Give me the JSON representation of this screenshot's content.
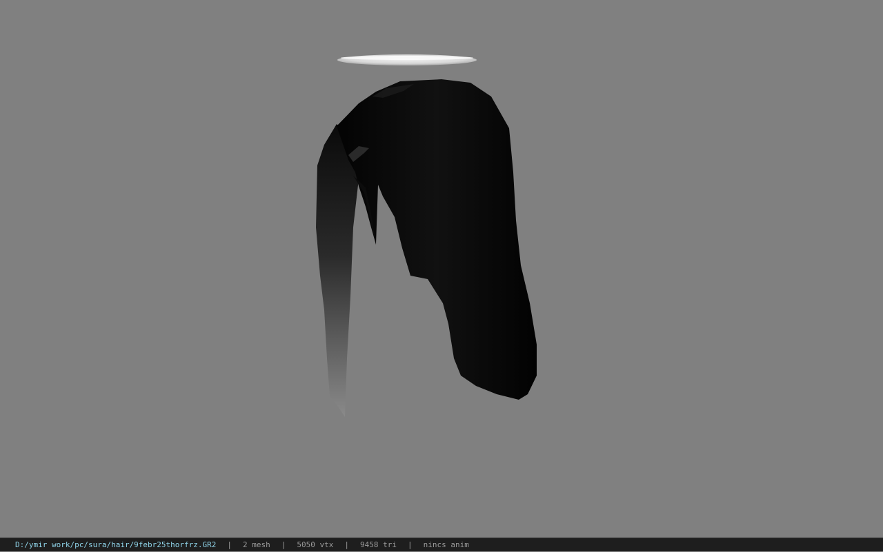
{
  "viewer": {
    "background_color": "#808080",
    "model_icon": "hair-mesh-model",
    "halo_icon": "halo-ring"
  },
  "statusbar": {
    "path_color": "#8fd3e8",
    "text_color": "#9a9a9a",
    "file_path": "D:/ymir work/pc/sura/hair/9febr25thorfrz.GR2",
    "separator": "|",
    "mesh_count": "2 mesh",
    "vertex_count": "5050 vtx",
    "triangle_count": "9458 tri",
    "animation": "nincs anim"
  }
}
